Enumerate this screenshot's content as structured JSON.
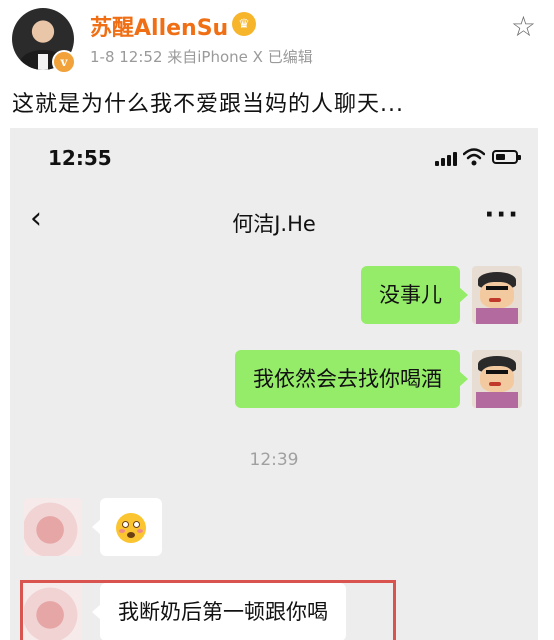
{
  "post": {
    "username": "苏醒AllenSu",
    "verify_badge": "v",
    "crown_badge": "♛",
    "meta": "1-8 12:52  来自iPhone X  已编辑",
    "text": "这就是为什么我不爱跟当妈的人聊天..."
  },
  "chat": {
    "status_time": "12:55",
    "contact_name": "何洁J.He",
    "back_glyph": "‹",
    "more_glyph": "···",
    "messages": [
      {
        "side": "right",
        "text": "没事儿"
      },
      {
        "side": "right",
        "text": "我依然会去找你喝酒"
      },
      {
        "side": "timestamp",
        "text": "12:39"
      },
      {
        "side": "left",
        "type": "emoji",
        "emoji": "flushed-face"
      },
      {
        "side": "left",
        "text": "我断奶后第一顿跟你喝"
      }
    ],
    "colors": {
      "background": "#ededed",
      "sent_bubble": "#95ec69",
      "received_bubble": "#ffffff",
      "highlight_border": "#d9534f",
      "username": "#f06f15"
    }
  }
}
